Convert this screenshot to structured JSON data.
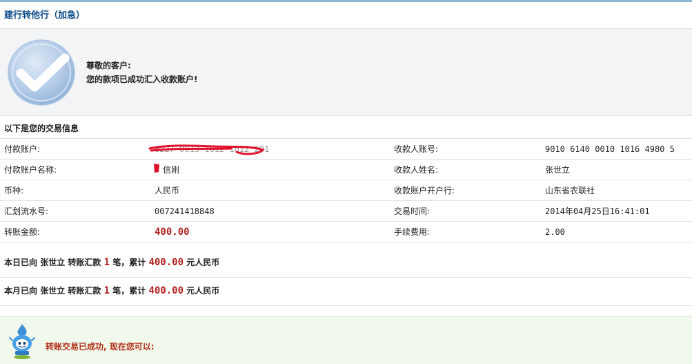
{
  "page": {
    "title": "建行转他行（加急）"
  },
  "success": {
    "greeting": "尊敬的客户:",
    "message": "您的款项已成功汇入收款账户!"
  },
  "section_title": "以下是您的交易信息",
  "rows": [
    {
      "label_left": "付款账户:",
      "value_left": "6227 0013 1612 1012 291",
      "label_right": "收款人账号:",
      "value_right": "9010 6140 0010 1016 4980 5"
    },
    {
      "label_left": "付款账户名称:",
      "value_left": "信刚",
      "label_right": "收款人姓名:",
      "value_right": "张世立"
    },
    {
      "label_left": "币种:",
      "value_left": "人民币",
      "label_right": "收款账户开户行:",
      "value_right": "山东省农联社"
    },
    {
      "label_left": "汇划流水号:",
      "value_left": "007241418848",
      "label_right": "交易时间:",
      "value_right": "2014年04月25日16:41:01"
    },
    {
      "label_left": "转账金额:",
      "value_left": "400.00",
      "label_right": "手续费用:",
      "value_right": "2.00"
    }
  ],
  "summary": {
    "day": {
      "prefix": "本日已向",
      "name": "张世立",
      "mid": "转账汇款",
      "count": "1",
      "unit": "笔，累计",
      "amount": "400.00",
      "suffix": "元人民币"
    },
    "month": {
      "prefix": "本月已向",
      "name": "张世立",
      "mid": "转账汇款",
      "count": "1",
      "unit": "笔，累计",
      "amount": "400.00",
      "suffix": "元人民币"
    }
  },
  "next": {
    "text": "转账交易已成功, 现在您可以:"
  },
  "colors": {
    "title": "#0b4b8a",
    "amount": "#b22222",
    "next_text": "#b03018",
    "scribble": "#e0102a"
  },
  "icons": {
    "success": "check-circle-icon",
    "mascot": "bank-mascot-icon"
  }
}
